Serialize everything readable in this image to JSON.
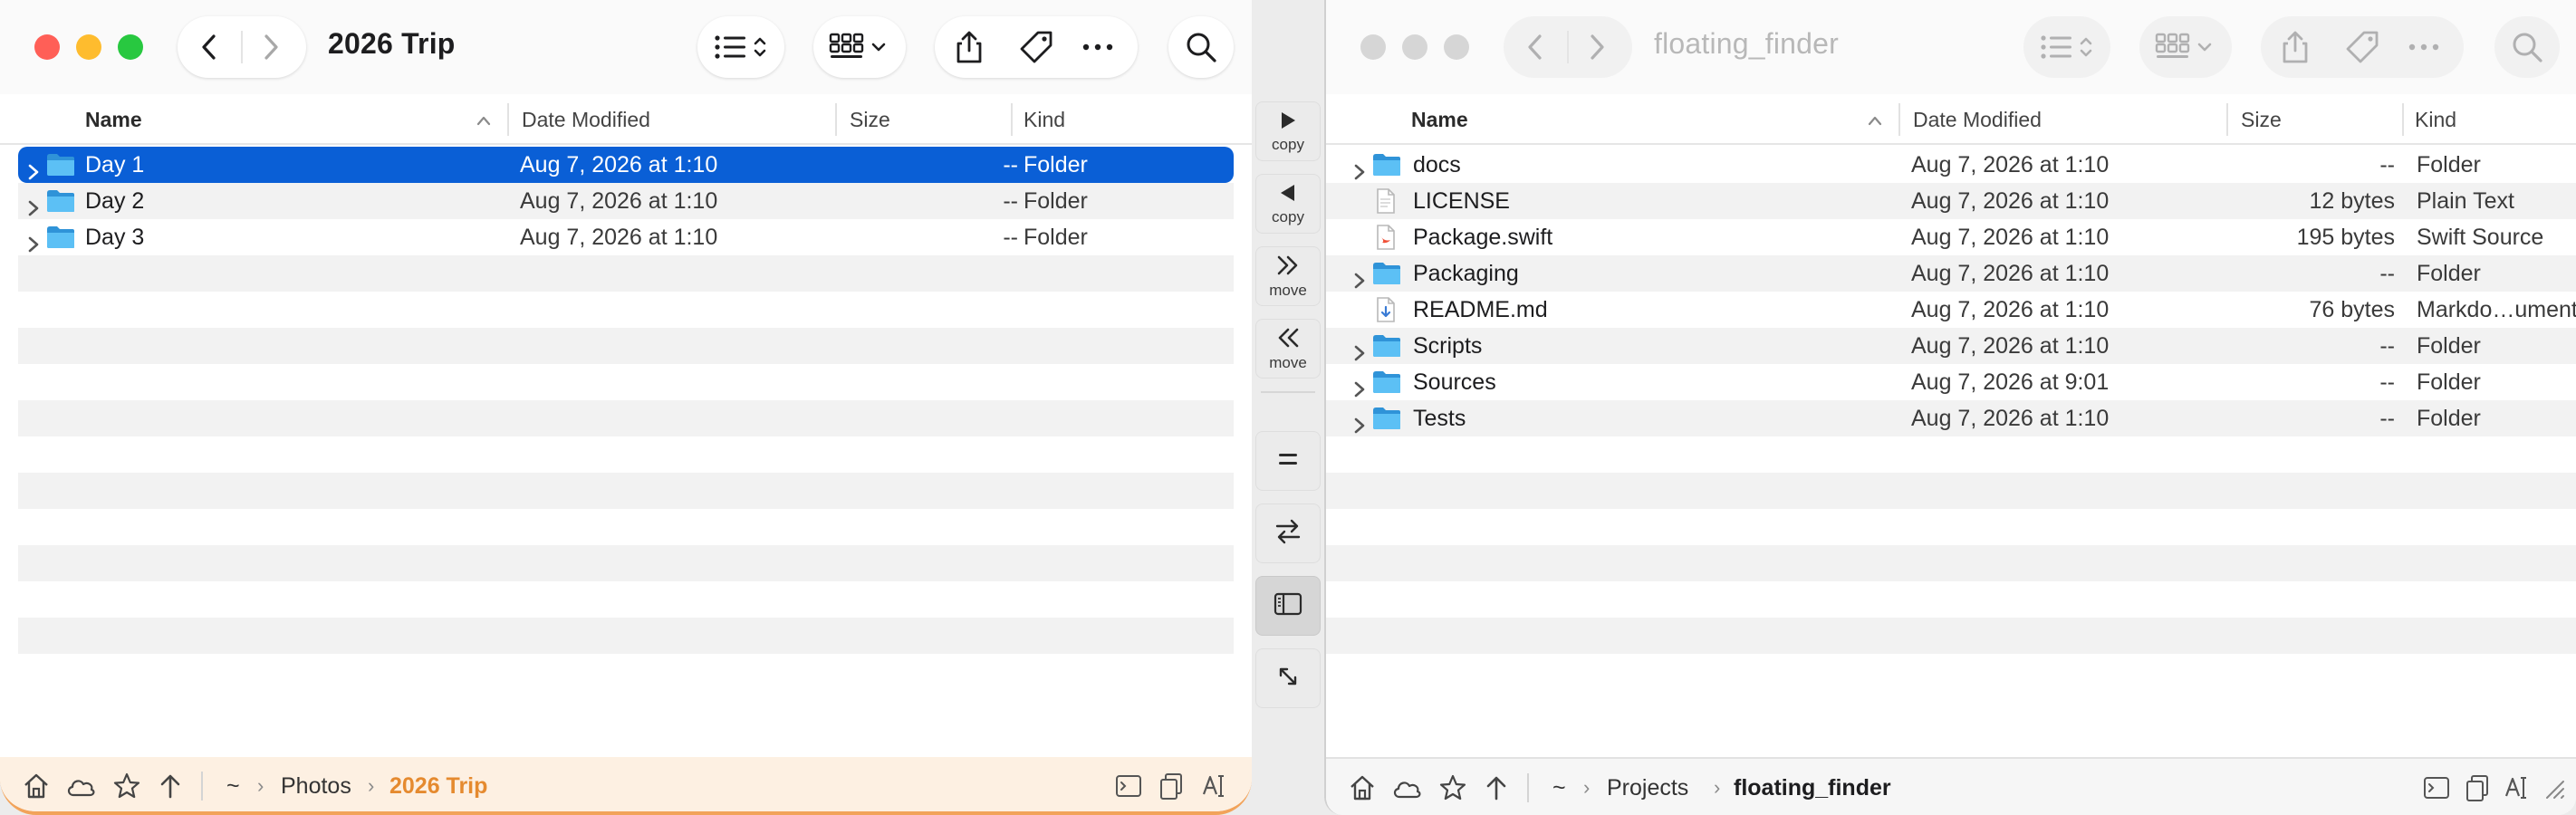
{
  "left_pane": {
    "title": "2026 Trip",
    "columns": {
      "name": "Name",
      "date": "Date Modified",
      "size": "Size",
      "kind": "Kind"
    },
    "rows": [
      {
        "name": "Day 1",
        "date": "Aug 7, 2026 at 1:10",
        "size": "--",
        "kind": "Folder",
        "icon": "folder-icon",
        "expandable": true,
        "selected": true
      },
      {
        "name": "Day 2",
        "date": "Aug 7, 2026 at 1:10",
        "size": "--",
        "kind": "Folder",
        "icon": "folder-icon",
        "expandable": true,
        "selected": false
      },
      {
        "name": "Day 3",
        "date": "Aug 7, 2026 at 1:10",
        "size": "--",
        "kind": "Folder",
        "icon": "folder-icon",
        "expandable": true,
        "selected": false
      }
    ],
    "path": {
      "root": "~",
      "parent": "Photos",
      "current": "2026 Trip"
    }
  },
  "right_pane": {
    "title": "floating_finder",
    "columns": {
      "name": "Name",
      "date": "Date Modified",
      "size": "Size",
      "kind": "Kind"
    },
    "rows": [
      {
        "name": "docs",
        "date": "Aug 7, 2026 at 1:10",
        "size": "--",
        "kind": "Folder",
        "icon": "folder-icon",
        "expandable": true
      },
      {
        "name": "LICENSE",
        "date": "Aug 7, 2026 at 1:10",
        "size": "12 bytes",
        "kind": "Plain Text",
        "icon": "text-file-icon",
        "expandable": false
      },
      {
        "name": "Package.swift",
        "date": "Aug 7, 2026 at 1:10",
        "size": "195 bytes",
        "kind": "Swift Source",
        "icon": "swift-file-icon",
        "expandable": false
      },
      {
        "name": "Packaging",
        "date": "Aug 7, 2026 at 1:10",
        "size": "--",
        "kind": "Folder",
        "icon": "folder-icon",
        "expandable": true
      },
      {
        "name": "README.md",
        "date": "Aug 7, 2026 at 1:10",
        "size": "76 bytes",
        "kind": "Markdo…ument",
        "icon": "markdown-file-icon",
        "expandable": false
      },
      {
        "name": "Scripts",
        "date": "Aug 7, 2026 at 1:10",
        "size": "--",
        "kind": "Folder",
        "icon": "folder-icon",
        "expandable": true
      },
      {
        "name": "Sources",
        "date": "Aug 7, 2026 at 9:01",
        "size": "--",
        "kind": "Folder",
        "icon": "folder-icon",
        "expandable": true
      },
      {
        "name": "Tests",
        "date": "Aug 7, 2026 at 1:10",
        "size": "--",
        "kind": "Folder",
        "icon": "folder-icon",
        "expandable": true
      }
    ],
    "path": {
      "root": "~",
      "parent": "Projects",
      "current": "floating_finder"
    }
  },
  "middle_buttons": [
    {
      "id": "copy-right-button",
      "icon": "play-right-icon",
      "label": "copy"
    },
    {
      "id": "copy-left-button",
      "icon": "play-left-icon",
      "label": "copy"
    },
    {
      "id": "move-right-button",
      "icon": "double-chevron-right-icon",
      "label": "move"
    },
    {
      "id": "move-left-button",
      "icon": "double-chevron-left-icon",
      "label": "move"
    },
    {
      "id": "equalize-button",
      "icon": "equals-icon",
      "label": ""
    },
    {
      "id": "swap-panes-button",
      "icon": "swap-arrows-icon",
      "label": ""
    },
    {
      "id": "sidebar-toggle-button",
      "icon": "sidebar-icon",
      "label": "",
      "active": true
    },
    {
      "id": "resize-button",
      "icon": "diagonal-arrows-icon",
      "label": ""
    }
  ],
  "colors": {
    "selection": "#0a5fd6",
    "active_accent": "#e58a2f",
    "folder": "#3fa8ec",
    "close": "#ff5f57",
    "minimize": "#febc2e",
    "zoom": "#28c840"
  }
}
